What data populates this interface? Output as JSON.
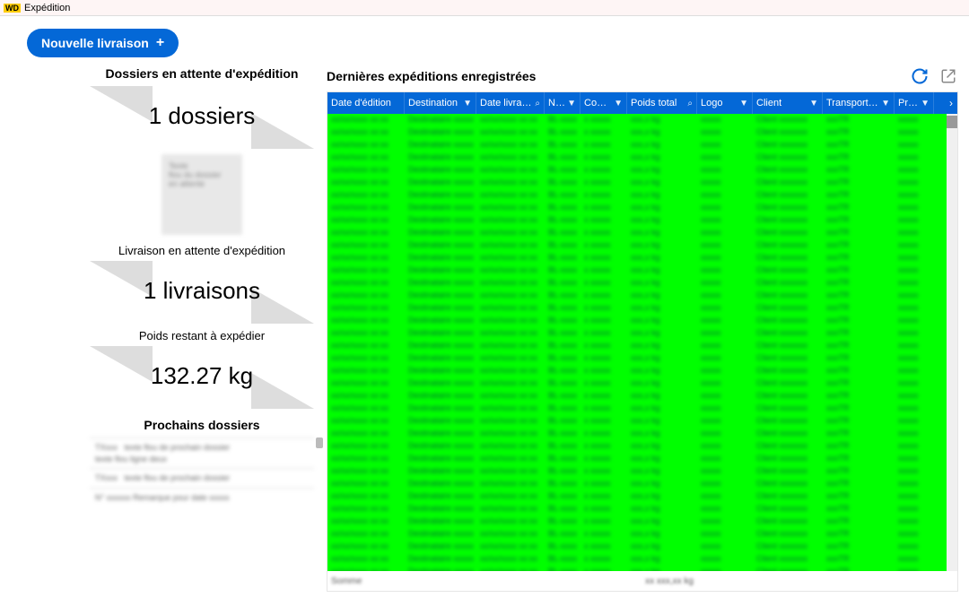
{
  "window": {
    "title": "Expédition"
  },
  "toolbar": {
    "new_delivery": "Nouvelle livraison"
  },
  "left": {
    "dossiers_title": "Dossiers en attente d'expédition",
    "dossiers_count": "1 dossiers",
    "livraison_title": "Livraison en attente d'expédition",
    "livraisons_count": "1 livraisons",
    "poids_title": "Poids restant à expédier",
    "poids_value": "132.27 kg",
    "prochains_title": "Prochains dossiers"
  },
  "right": {
    "title": "Dernières expéditions enregistrées",
    "columns": [
      {
        "label": "Date d'édition",
        "icon": ""
      },
      {
        "label": "Destination",
        "icon": "filter"
      },
      {
        "label": "Date livraison",
        "icon": "search"
      },
      {
        "label": "N° BL",
        "icon": "filter"
      },
      {
        "label": "Contenu",
        "icon": "filter"
      },
      {
        "label": "Poids total",
        "icon": "search"
      },
      {
        "label": "Logo",
        "icon": "filter"
      },
      {
        "label": "Client",
        "icon": "filter"
      },
      {
        "label": "Transporteur",
        "icon": "filter"
      },
      {
        "label": "Produit",
        "icon": "filter"
      }
    ]
  }
}
